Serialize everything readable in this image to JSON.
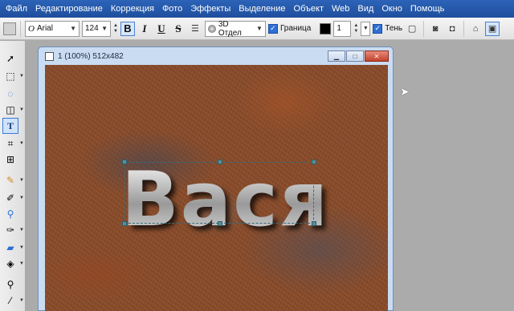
{
  "menu": {
    "items": [
      "Файл",
      "Редактирование",
      "Коррекция",
      "Фото",
      "Эффекты",
      "Выделение",
      "Объект",
      "Web",
      "Вид",
      "Окно",
      "Помощь"
    ]
  },
  "toolbar": {
    "font_name": "Arial",
    "font_size": "124",
    "bold": "B",
    "italic": "I",
    "underline": "U",
    "strikethrough": "S",
    "effect_3d": "3D Отдел",
    "border_label": "Граница",
    "border_width": "1",
    "shadow_label": "Тень"
  },
  "document": {
    "title": "1 (100%) 512x482",
    "text_content": "Вася"
  },
  "tools": [
    "arrow-tool-icon",
    "marquee-tool-icon",
    "lasso-tool-icon",
    "shape-tool-icon",
    "text-tool-icon",
    "crop-tool-icon",
    "transform-tool-icon",
    "brush-tool-icon",
    "pencil-tool-icon",
    "stamp-tool-icon",
    "clone-tool-icon",
    "eraser-tool-icon",
    "fill-tool-icon",
    "zoom-tool-icon",
    "eyedropper-tool-icon"
  ],
  "colors": {
    "menubar": "#1f4f9d",
    "accent": "#2d6fd6",
    "desktop": "#ababab"
  }
}
